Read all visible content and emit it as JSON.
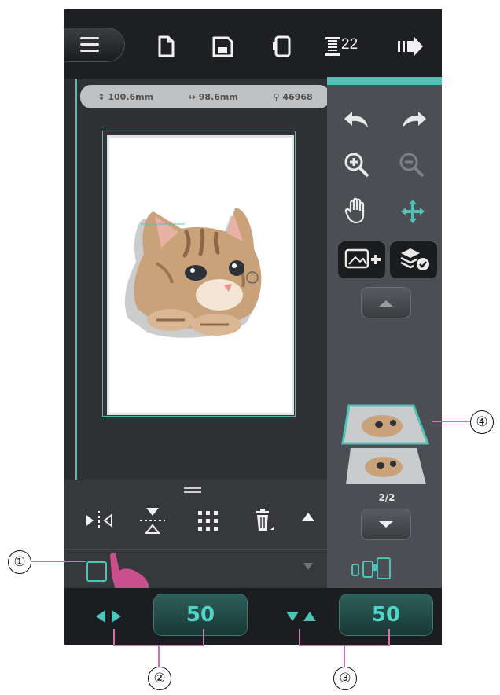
{
  "toolbar": {
    "thread_count": "22"
  },
  "canvas": {
    "height_value": "100.6mm",
    "width_value": "98.6mm",
    "stitch_count": "46968"
  },
  "right_panel": {
    "page_indicator": "2/2"
  },
  "bottom_bar": {
    "horizontal_value": "50",
    "vertical_value": "50"
  },
  "callouts": [
    "①",
    "②",
    "③",
    "④"
  ],
  "colors": {
    "accent": "#4fc3b8",
    "callout_line": "#de6db0",
    "value_text": "#4fd5c8"
  }
}
